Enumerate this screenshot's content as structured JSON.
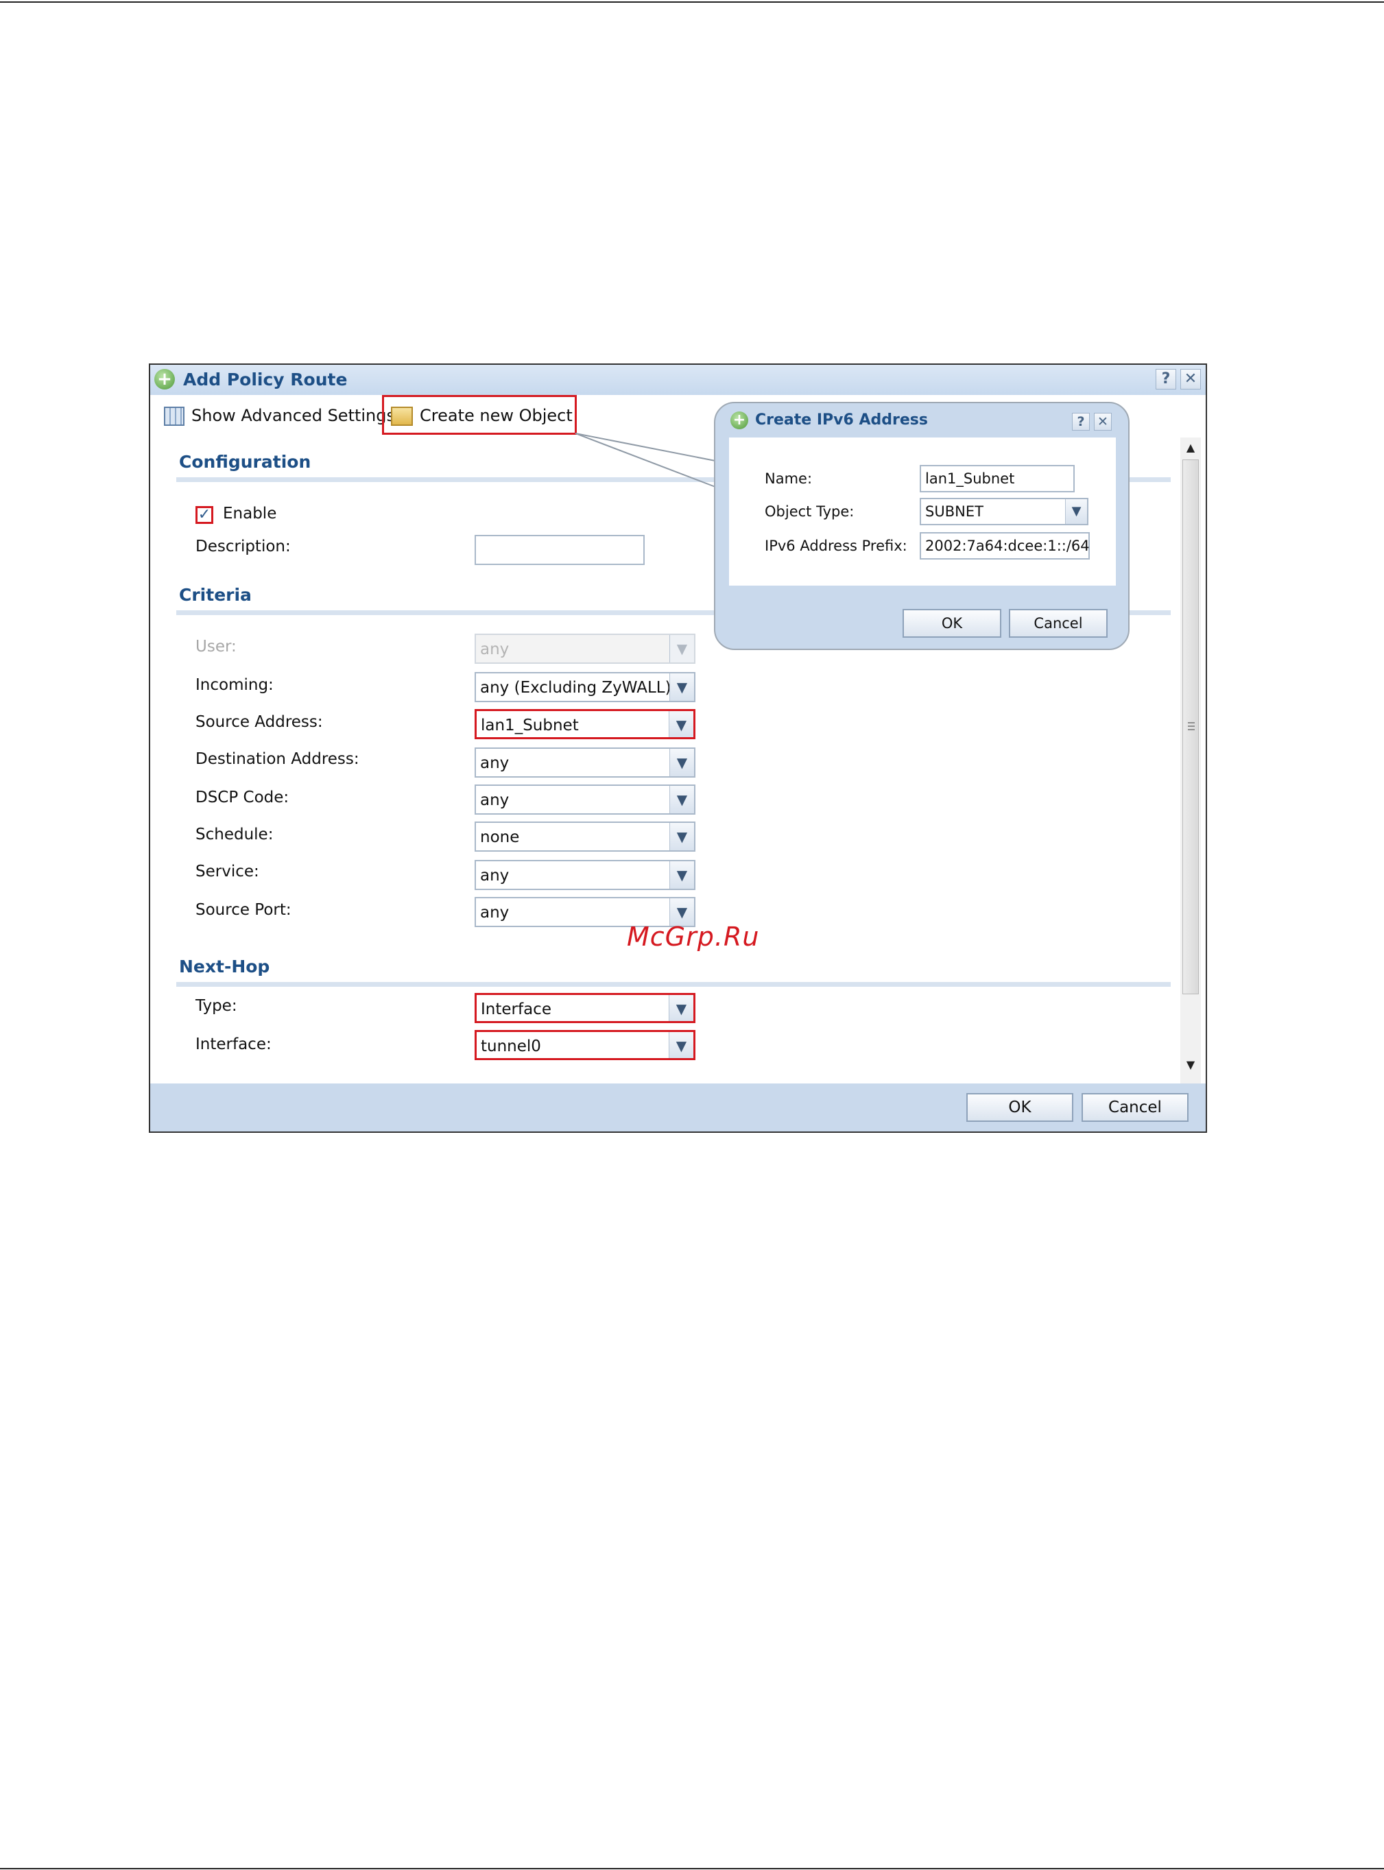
{
  "window": {
    "title": "Add Policy Route",
    "help_glyph": "?",
    "close_glyph": "✕"
  },
  "toolbar": {
    "advanced_settings_label": "Show Advanced Settings",
    "create_object_label": "Create new Object",
    "create_object_caret": "▾"
  },
  "sections": {
    "configuration": "Configuration",
    "criteria": "Criteria",
    "next_hop": "Next-Hop"
  },
  "configuration": {
    "enable_label": "Enable",
    "enable_checked": true,
    "checkmark": "✓",
    "description_label": "Description:",
    "description_value": ""
  },
  "criteria": {
    "user": {
      "label": "User:",
      "value": "any",
      "disabled": true
    },
    "incoming": {
      "label": "Incoming:",
      "value": "any (Excluding ZyWALL)"
    },
    "source_address": {
      "label": "Source Address:",
      "value": "lan1_Subnet"
    },
    "destination_address": {
      "label": "Destination Address:",
      "value": "any"
    },
    "dscp_code": {
      "label": "DSCP Code:",
      "value": "any"
    },
    "schedule": {
      "label": "Schedule:",
      "value": "none"
    },
    "service": {
      "label": "Service:",
      "value": "any"
    },
    "source_port": {
      "label": "Source Port:",
      "value": "any"
    }
  },
  "next_hop": {
    "type": {
      "label": "Type:",
      "value": "Interface"
    },
    "interface": {
      "label": "Interface:",
      "value": "tunnel0"
    }
  },
  "dropdown_arrow": "▼",
  "scrollbar": {
    "up_arrow": "▲",
    "down_arrow": "▼"
  },
  "footer": {
    "ok_label": "OK",
    "cancel_label": "Cancel"
  },
  "popup": {
    "title": "Create IPv6 Address",
    "help_glyph": "?",
    "close_glyph": "✕",
    "name_label": "Name:",
    "name_value": "lan1_Subnet",
    "object_type_label": "Object Type:",
    "object_type_value": "SUBNET",
    "prefix_label": "IPv6 Address Prefix:",
    "prefix_value": "2002:7a64:dcee:1::/64",
    "ok_label": "OK",
    "cancel_label": "Cancel"
  },
  "watermark": "McGrp.Ru",
  "colors": {
    "highlight": "#d51920",
    "title_blue": "#1d4f86",
    "panel_blue": "#c9d9ec"
  }
}
